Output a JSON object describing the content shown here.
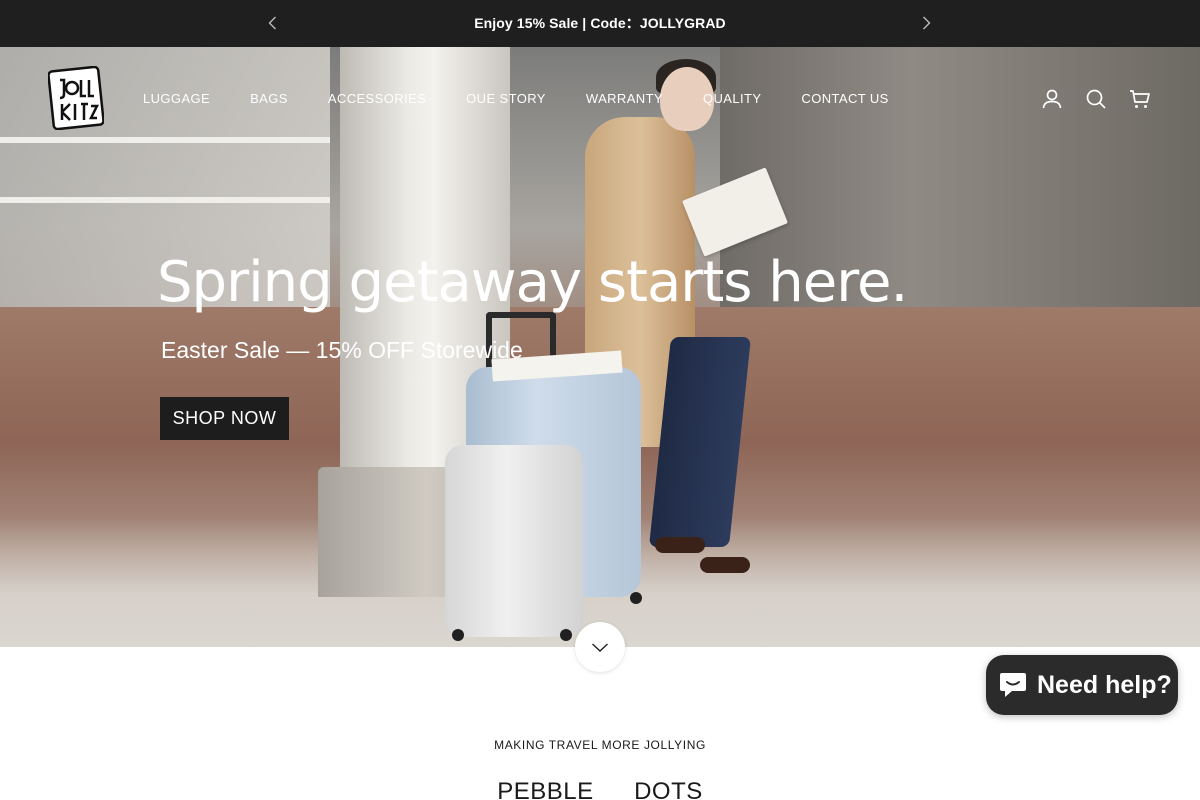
{
  "announcement": {
    "text": "Enjoy 15% Sale | Code：JOLLYGRAD",
    "prev_icon": "chevron-left-icon",
    "next_icon": "chevron-right-icon"
  },
  "header": {
    "logo_text": "JOLLY KITE",
    "nav": [
      "LUGGAGE",
      "BAGS",
      "ACCESSORIES",
      "OUE STORY",
      "WARRANTY",
      "QUALITY",
      "CONTACT US"
    ],
    "icons": [
      "account-icon",
      "search-icon",
      "cart-icon"
    ]
  },
  "hero": {
    "headline": "Spring getaway starts here.",
    "subline": "Easter Sale — 15% OFF Storewide",
    "cta": "SHOP NOW",
    "scroll_icon": "chevron-down-icon"
  },
  "chat": {
    "label": "Need help?",
    "icon": "chat-bubble-icon"
  },
  "section": {
    "tagline": "MAKING TRAVEL MORE JOLLYING",
    "tabs": [
      "PEBBLE",
      "DOTS"
    ]
  },
  "colors": {
    "announcement_bg": "#1f1f1f",
    "button_bg": "#1d1d1d",
    "chat_bg": "#2b2b2b"
  }
}
